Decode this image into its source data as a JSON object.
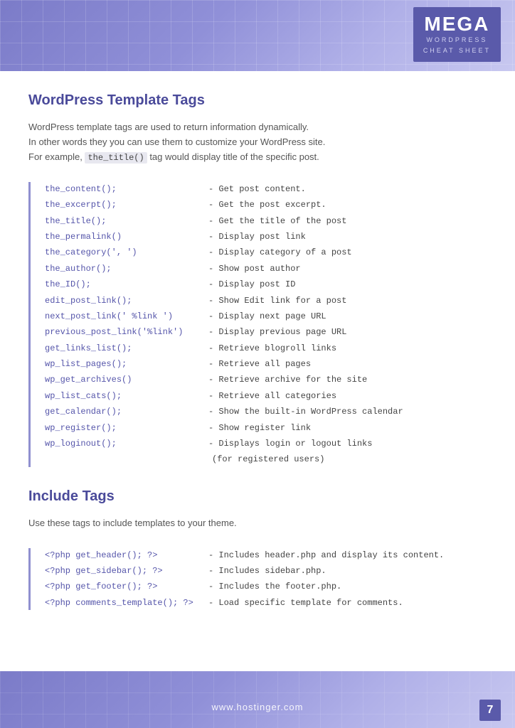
{
  "header": {
    "logo_mega": "MEGA",
    "logo_line1": "WORDPRESS",
    "logo_line2": "CHEAT SHEET"
  },
  "section1": {
    "title": "WordPress Template Tags",
    "intro_text": "WordPress template tags are used to return information dynamically.\nIn other words they you can use them to customize your WordPress site.\nFor example,",
    "intro_code": "the_title()",
    "intro_text2": "tag would display title of the specific post.",
    "code_rows": [
      {
        "left": "the_content();",
        "right": "- Get post content."
      },
      {
        "left": "the_excerpt();",
        "right": "- Get the post excerpt."
      },
      {
        "left": "the_title();",
        "right": "- Get the title of the post"
      },
      {
        "left": "the_permalink()",
        "right": "- Display post link"
      },
      {
        "left": "the_category(', ')",
        "right": "- Display category of a post"
      },
      {
        "left": "the_author();",
        "right": "- Show post author"
      },
      {
        "left": "the_ID();",
        "right": "- Display post ID"
      },
      {
        "left": "edit_post_link();",
        "right": "- Show Edit link for a post"
      },
      {
        "left": "next_post_link(' %link ')",
        "right": "- Display next page URL"
      },
      {
        "left": "previous_post_link('%link')",
        "right": "- Display previous page URL"
      },
      {
        "left": "get_links_list();",
        "right": "- Retrieve blogroll links"
      },
      {
        "left": "wp_list_pages();",
        "right": "- Retrieve all pages"
      },
      {
        "left": "wp_get_archives()",
        "right": "- Retrieve archive for the site"
      },
      {
        "left": "wp_list_cats();",
        "right": "- Retrieve all categories"
      },
      {
        "left": "get_calendar();",
        "right": "- Show the built-in WordPress calendar"
      },
      {
        "left": "wp_register();",
        "right": "- Show register link"
      },
      {
        "left": "wp_loginout();",
        "right": "- Displays login or logout links",
        "extra": "(for registered users)"
      }
    ]
  },
  "section2": {
    "title": "Include Tags",
    "intro_text": "Use these tags to include templates to your theme.",
    "code_rows": [
      {
        "left": "<?php get_header(); ?>",
        "right": "- Includes header.php and display its content."
      },
      {
        "left": "<?php get_sidebar(); ?>",
        "right": "- Includes sidebar.php."
      },
      {
        "left": "<?php get_footer(); ?>",
        "right": "- Includes the footer.php."
      },
      {
        "left": "<?php comments_template(); ?>",
        "right": "- Load specific template for comments."
      }
    ]
  },
  "footer": {
    "url": "www.hostinger.com",
    "page_number": "7"
  }
}
